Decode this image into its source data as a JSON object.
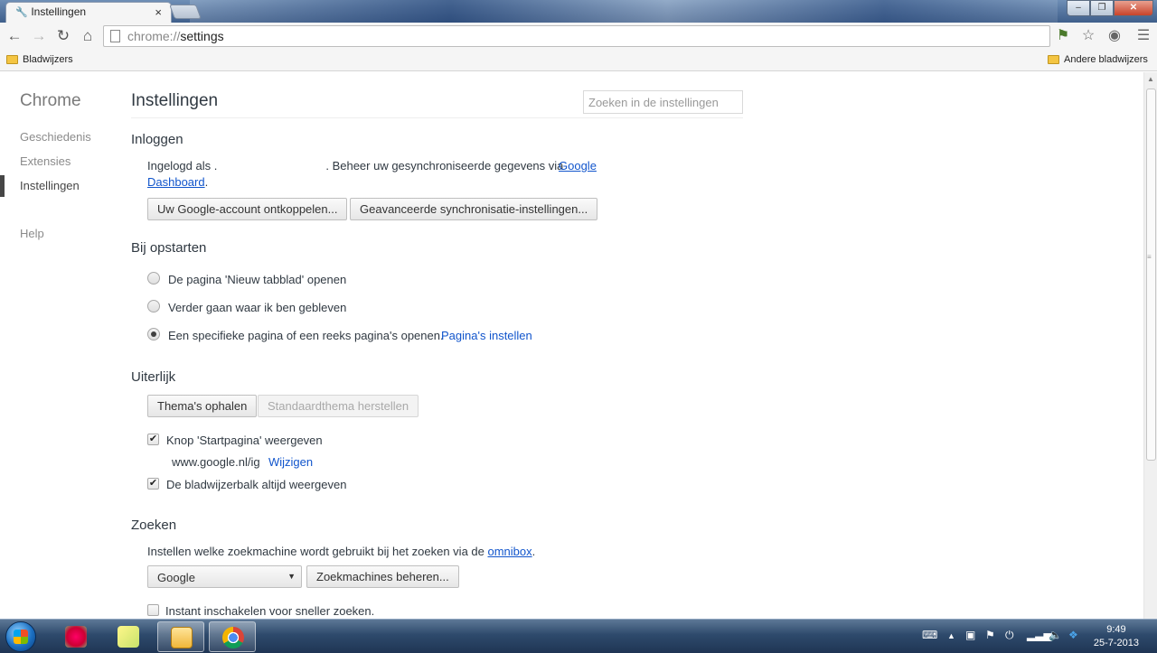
{
  "window": {
    "tab_title": "Instellingen",
    "tab_close": "×",
    "controls": {
      "minimize": "–",
      "maximize": "❐",
      "close": "✕"
    }
  },
  "toolbar": {
    "url_scheme": "chrome://",
    "url_path": "settings",
    "icons": [
      "back-icon",
      "forward-icon",
      "reload-icon",
      "home-icon",
      "flag-icon",
      "star-icon",
      "extension-icon",
      "menu-icon"
    ]
  },
  "bookmarks": {
    "left": "Bladwijzers",
    "right": "Andere bladwijzers"
  },
  "sidebar": {
    "title": "Chrome",
    "items": [
      {
        "label": "Geschiedenis"
      },
      {
        "label": "Extensies"
      },
      {
        "label": "Instellingen"
      },
      {
        "label": "Help"
      }
    ]
  },
  "main": {
    "title": "Instellingen",
    "search_placeholder": "Zoeken in de instellingen",
    "signin": {
      "title": "Inloggen",
      "text_prefix": "Ingelogd als .",
      "text_middle": ". Beheer uw gesynchroniseerde gegevens via",
      "link": "Google Dashboard",
      "text_suffix": ".",
      "disconnect_button": "Uw Google-account ontkoppelen...",
      "sync_button": "Geavanceerde synchronisatie-instellingen..."
    },
    "startup": {
      "title": "Bij opstarten",
      "options": [
        "De pagina 'Nieuw tabblad' openen",
        "Verder gaan waar ik ben gebleven",
        "Een specifieke pagina of een reeks pagina's openen."
      ],
      "selected_index": 2,
      "set_pages_link": "Pagina's instellen"
    },
    "appearance": {
      "title": "Uiterlijk",
      "get_themes_button": "Thema's ophalen",
      "reset_theme_button": "Standaardthema herstellen",
      "home_button_label": "Knop 'Startpagina' weergeven",
      "home_url": "www.google.nl/ig",
      "change_link": "Wijzigen",
      "bookmarks_bar_label": "De bladwijzerbalk altijd weergeven"
    },
    "search": {
      "title": "Zoeken",
      "description_prefix": "Instellen welke zoekmachine wordt gebruikt bij het zoeken via de",
      "omnibox_link": "omnibox",
      "description_suffix": ".",
      "engine_selected": "Google",
      "manage_button": "Zoekmachines beheren...",
      "instant_label": "Instant inschakelen voor sneller zoeken."
    }
  },
  "taskbar": {
    "time": "9:49",
    "date": "25-7-2013",
    "apps": [
      "paint-icon",
      "notes-icon",
      "outlook-icon",
      "chrome-icon"
    ]
  }
}
